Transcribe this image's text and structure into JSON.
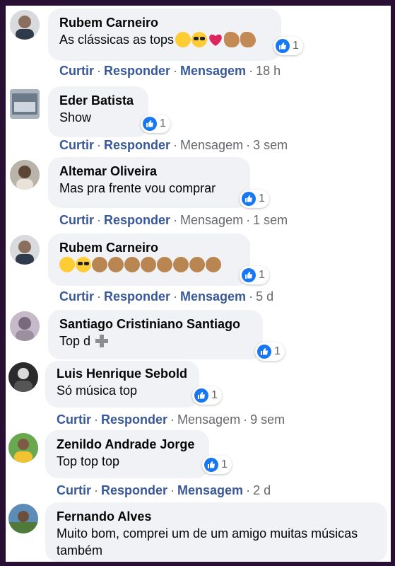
{
  "colors": {
    "link": "#385898",
    "muted": "#65676b",
    "bubble": "#f0f2f5",
    "like_blue": "#1877f2",
    "outer_border": "#2a0f35"
  },
  "labels": {
    "like": "Curtir",
    "reply": "Responder",
    "message": "Mensagem",
    "dot": "·"
  },
  "comments": [
    {
      "author": "Rubem Carneiro",
      "text": "As clássicas as tops",
      "emojis": [
        "wink",
        "cool",
        "heart",
        "arm",
        "arm"
      ],
      "reactions": "1",
      "time": "18 h"
    },
    {
      "author": "Eder Batista",
      "text": "Show",
      "reactions": "1",
      "time": "3 sem"
    },
    {
      "author": "Altemar Oliveira",
      "text": "Mas pra frente vou comprar",
      "reactions": "1",
      "time": "1 sem"
    },
    {
      "author": "Rubem Carneiro",
      "text": "",
      "emojis": [
        "wink",
        "cool",
        "clap",
        "clap",
        "clap",
        "clap",
        "clap",
        "clap",
        "clap",
        "clap"
      ],
      "reactions": "1",
      "time": "5 d"
    },
    {
      "author": "Santiago Cristiniano Santiago",
      "text": "Top d",
      "emojis": [
        "plus"
      ],
      "reactions": "1"
    },
    {
      "author": "Luis Henrique Sebold",
      "text": "Só música top",
      "reactions": "1",
      "time": "9 sem"
    },
    {
      "author": "Zenildo Andrade Jorge",
      "text": "Top top top",
      "reactions": "1",
      "time": "2 d"
    },
    {
      "author": "Fernando Alves",
      "text": "Muito bom, comprei um de um amigo muitas músicas também"
    }
  ]
}
